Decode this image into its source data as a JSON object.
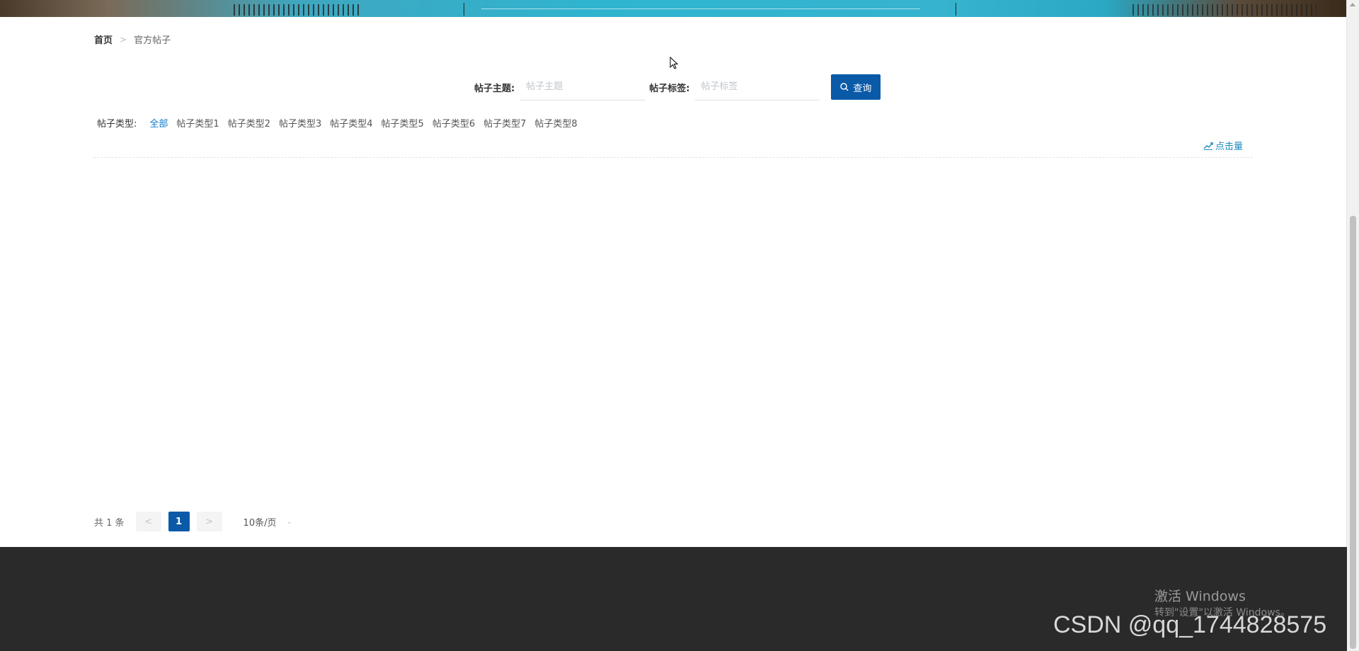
{
  "breadcrumb": {
    "home": "首页",
    "separator": ">",
    "current": "官方帖子"
  },
  "search": {
    "subject_label": "帖子主题:",
    "subject_placeholder": "帖子主题",
    "subject_value": "",
    "tag_label": "帖子标签:",
    "tag_placeholder": "帖子标签",
    "tag_value": "",
    "query_button": "查询",
    "query_icon": "search-icon"
  },
  "type_filter": {
    "label": "帖子类型:",
    "items": [
      "全部",
      "帖子类型1",
      "帖子类型2",
      "帖子类型3",
      "帖子类型4",
      "帖子类型5",
      "帖子类型6",
      "帖子类型7",
      "帖子类型8"
    ],
    "active": "全部"
  },
  "sort": {
    "label": "点击量",
    "icon": "trend-icon"
  },
  "pagination": {
    "total": "共 1 条",
    "prev": "<",
    "current_page": "1",
    "next": ">",
    "page_size": "10条/页"
  },
  "overlay": {
    "activate_title": "激活 Windows",
    "activate_sub": "转到\"设置\"以激活 Windows。",
    "watermark": "CSDN @qq_1744828575"
  },
  "colors": {
    "accent": "#0a5aa8",
    "active_link": "#0a7ac6",
    "footer_bg": "#2a2a2a"
  }
}
